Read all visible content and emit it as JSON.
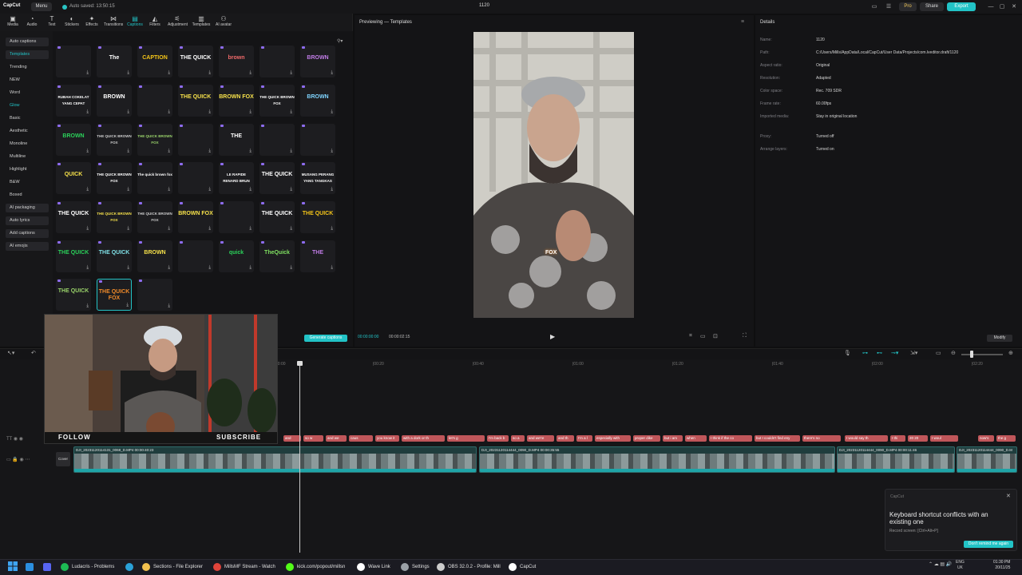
{
  "app": {
    "logo": "CapCut",
    "menu_label": "Menu",
    "autosave_text": "Auto saved: 13:50:15",
    "project_title": "1120",
    "pro_label": "Pro",
    "share_label": "Share",
    "export_label": "Export",
    "accent_color": "#22c3c6"
  },
  "toolbar": {
    "items": [
      {
        "label": "Media",
        "icon": "media-icon"
      },
      {
        "label": "Audio",
        "icon": "audio-icon"
      },
      {
        "label": "Text",
        "icon": "text-icon"
      },
      {
        "label": "Stickers",
        "icon": "stickers-icon"
      },
      {
        "label": "Effects",
        "icon": "effects-icon"
      },
      {
        "label": "Transitions",
        "icon": "transitions-icon"
      },
      {
        "label": "Captions",
        "icon": "captions-icon",
        "active": true
      },
      {
        "label": "Filters",
        "icon": "filters-icon"
      },
      {
        "label": "Adjustment",
        "icon": "adjustment-icon"
      },
      {
        "label": "Templates",
        "icon": "templates-icon"
      },
      {
        "label": "AI avatar",
        "icon": "ai-avatar-icon"
      }
    ]
  },
  "categories": {
    "auto_captions": "Auto captions",
    "templates": "Templates",
    "trending": "Trending",
    "new": "NEW",
    "word": "Word",
    "glow": "Glow",
    "basic": "Basic",
    "aesthetic": "Aesthetic",
    "monoline": "Monoline",
    "multiline": "Multiline",
    "highlight": "Highlight",
    "bw": "B&W",
    "boxed": "Boxed",
    "ai_packaging": "AI packaging",
    "auto_lyrics": "Auto lyrics",
    "add_captions": "Add captions",
    "ai_emojis": "AI emojis"
  },
  "templates": [
    [
      "",
      "The",
      "CAPTION",
      "THE QUICK",
      "brown",
      "",
      "BROWN"
    ],
    [
      "RUBAH COKELAT YANG CEPAT",
      "BROWN",
      "",
      "THE QUICK",
      "BROWN FOX",
      "THE QUICK BROWN FOX",
      "BROWN"
    ],
    [
      "BROWN",
      "THE QUICK BROWN FOX",
      "THE QUICK BROWN FOX",
      "",
      "THE",
      "",
      ""
    ],
    [
      "QUICK",
      "THE QUICK BROWN FOX",
      "The quick brown fox",
      "",
      "LE RAPIDE RENARD BRUN",
      "THE QUICK",
      "MUSANG PERANG YANG TANGKAS"
    ],
    [
      "THE QUICK",
      "THE QUICK BROWN FOX",
      "THE QUICK BROWN FOX",
      "BROWN FOX",
      "",
      "THE QUICK",
      "THE QUICK"
    ],
    [
      "THE QUICK",
      "THE QUICK",
      "BROWN",
      "",
      "quick",
      "TheQuick",
      "THE"
    ],
    [
      "THE QUICK",
      "THE QUICK FOX",
      ""
    ]
  ],
  "generate_captions_label": "Generate captions",
  "pro_badge": "Pro",
  "preview": {
    "title": "Previewing — Templates",
    "timecode_current": "00:00:00:00",
    "timecode_total": "00:00:02:15",
    "caption_on_video": "FOX"
  },
  "details": {
    "title": "Details",
    "rows": [
      {
        "key": "Name:",
        "value": "1120"
      },
      {
        "key": "Path:",
        "value": "C:/Users/Mills/AppData/Local/CapCut/User Data/Projects/com.lveditor.draft/1120"
      },
      {
        "key": "Aspect ratio:",
        "value": "Original"
      },
      {
        "key": "Resolution:",
        "value": "Adapted"
      },
      {
        "key": "Color space:",
        "value": "Rec. 709 SDR"
      },
      {
        "key": "Frame rate:",
        "value": "60.00fps"
      },
      {
        "key": "Imported media:",
        "value": "Stay in original location"
      },
      {
        "key": "Proxy:",
        "value": "Turned off"
      },
      {
        "key": "Arrange layers:",
        "value": "Turned on"
      }
    ],
    "modify_label": "Modify"
  },
  "timeline": {
    "ruler": [
      "00:00",
      "|00:20",
      "|00:40",
      "|01:00",
      "|01:20",
      "|01:40",
      "|02:00",
      "|02:20",
      "|02:40"
    ],
    "caption_clips": [
      "and",
      "so w",
      "and we",
      "caus",
      "you know it",
      "with a dork or th",
      "let's g",
      "I'm back b",
      "so a",
      "and we're",
      "and th",
      "I'm a l",
      "especially with",
      "proper dike",
      "but i am",
      "when",
      "I think if the co",
      "but I couldn't find eny",
      "there's no",
      "I would say th",
      "I thi",
      "20 20",
      "I woul",
      "now's",
      "the g"
    ],
    "video_clips": [
      {
        "label": "DJI_20231120114131_0068_D.MP4   00:00:40:23"
      },
      {
        "label": "DJI_20231120114444_0090_D.MP4   00:00:35:55"
      },
      {
        "label": "DJI_20231120114444_0090_D.MP4   00:00:11:46"
      },
      {
        "label": "DJI_20231120114444_0090_D.M"
      }
    ],
    "cover_label": "Cover"
  },
  "webcam": {
    "follow": "FOLLOW",
    "subscribe": "SUBSCRIBE"
  },
  "notification": {
    "app": "CapCut",
    "title": "Keyboard shortcut conflicts with an existing one",
    "subtitle": "Record screen: [Ctrl+Alt+P]",
    "button": "Don't remind me again"
  },
  "taskbar": {
    "items": [
      {
        "label": "Ludacris - Problems",
        "color": "#1db954"
      },
      {
        "label": "",
        "color": "#2aa1d8"
      },
      {
        "label": "Sections - File Explorer",
        "color": "#f2c14e"
      },
      {
        "label": "MillsMF Stream - Watch",
        "color": "#e0443b"
      },
      {
        "label": "kick.com/popout/millsn",
        "color": "#53fc18"
      },
      {
        "label": "Wave Link",
        "color": "#ffffff"
      },
      {
        "label": "Settings",
        "color": "#9aa0a6"
      },
      {
        "label": "OBS 32.0.2 - Profile: Mill",
        "color": "#cccccc"
      },
      {
        "label": "CapCut",
        "color": "#ffffff"
      }
    ],
    "lang_line1": "ENG",
    "lang_line2": "UK",
    "time": "01:30 PM",
    "date": "20/11/25"
  }
}
